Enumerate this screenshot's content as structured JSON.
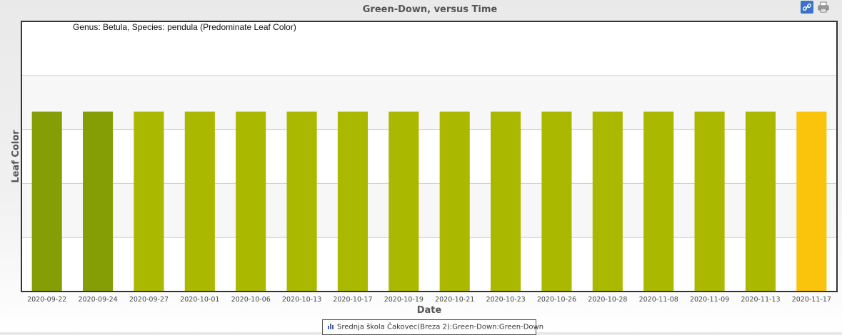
{
  "header": {
    "title": "Green-Down, versus Time",
    "link_icon": "link-icon",
    "print_icon": "printer-icon"
  },
  "chart_data": {
    "type": "bar",
    "title": "Green-Down, versus Time",
    "subtitle": "Genus: Betula, Species: pendula (Predominate Leaf Color)",
    "xlabel": "Date",
    "ylabel": "Leaf Color",
    "categories": [
      "2020-09-22",
      "2020-09-24",
      "2020-09-27",
      "2020-10-01",
      "2020-10-06",
      "2020-10-13",
      "2020-10-17",
      "2020-10-19",
      "2020-10-21",
      "2020-10-23",
      "2020-10-26",
      "2020-10-28",
      "2020-11-08",
      "2020-11-09",
      "2020-11-13",
      "2020-11-17"
    ],
    "values": [
      3.33,
      3.33,
      3.33,
      3.33,
      3.33,
      3.33,
      3.33,
      3.33,
      3.33,
      3.33,
      3.33,
      3.33,
      3.33,
      3.33,
      3.33,
      3.33
    ],
    "bar_colors": [
      "#869e06",
      "#869e06",
      "#abb800",
      "#abb800",
      "#abb800",
      "#abb800",
      "#abb800",
      "#abb800",
      "#abb800",
      "#abb800",
      "#abb800",
      "#abb800",
      "#abb800",
      "#abb800",
      "#abb800",
      "#fac30c"
    ],
    "ylim": [
      0,
      5
    ],
    "grid": true,
    "series": [
      {
        "name": "Srednja škola Čakovec(Breza 2):Green-Down:Green-Down"
      }
    ],
    "legend_position": "bottom"
  }
}
